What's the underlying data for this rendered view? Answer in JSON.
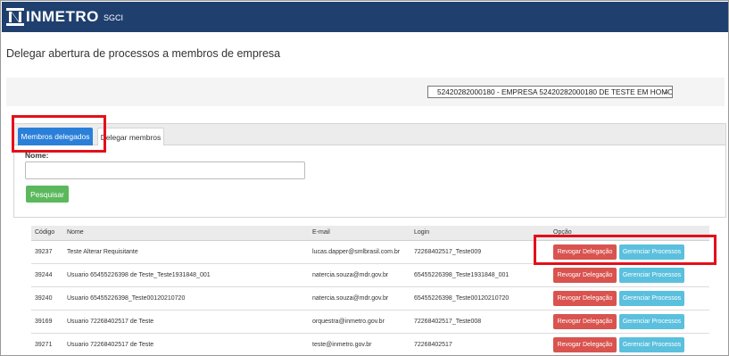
{
  "header": {
    "logo_text": "INMETRO",
    "app_name": "SGCI"
  },
  "page": {
    "title": "Delegar abertura de processos a membros de empresa"
  },
  "company_select": {
    "value": "52420282000180 - EMPRESA 52420282000180 DE TESTE EM HOMO"
  },
  "tabs": [
    {
      "label": "Membros delegados",
      "active": true
    },
    {
      "label": "Delegar membros",
      "active": false
    }
  ],
  "filter": {
    "nome_label": "Nome:",
    "nome_value": "",
    "search_label": "Pesquisar"
  },
  "table": {
    "columns": [
      "Código",
      "Nome",
      "E-mail",
      "Login",
      "Opção"
    ],
    "rows": [
      {
        "codigo": "39237",
        "nome": "Teste Alterar Requisitante",
        "email": "lucas.dapper@smlbrasil.com.br",
        "login": "72268402517_Teste009"
      },
      {
        "codigo": "39244",
        "nome": "Usuario 65455226398 de Teste_Teste1931848_001",
        "email": "natercia.souza@mdr.gov.br",
        "login": "65455226398_Teste1931848_001"
      },
      {
        "codigo": "39240",
        "nome": "Usuario 65455226398_Teste00120210720",
        "email": "natercia.souza@mdr.gov.br",
        "login": "65455226398_Teste00120210720"
      },
      {
        "codigo": "39169",
        "nome": "Usuario 72268402517 de Teste",
        "email": "orquestra@inmetro.gov.br",
        "login": "72268402517_Teste008"
      },
      {
        "codigo": "39271",
        "nome": "Usuario 72268402517 de Teste",
        "email": "teste@inmetro.gov.br",
        "login": "72268402517"
      }
    ],
    "revogar_label": "Revogar Delegação",
    "gerenciar_label": "Gerenciar Processos"
  },
  "colors": {
    "header_bg": "#1f3f6e",
    "tab_active": "#2a7fd8",
    "btn_search": "#5cb85c",
    "btn_revogar": "#d9534f",
    "btn_gerenciar": "#5bc0de",
    "highlight": "#e3101a"
  }
}
